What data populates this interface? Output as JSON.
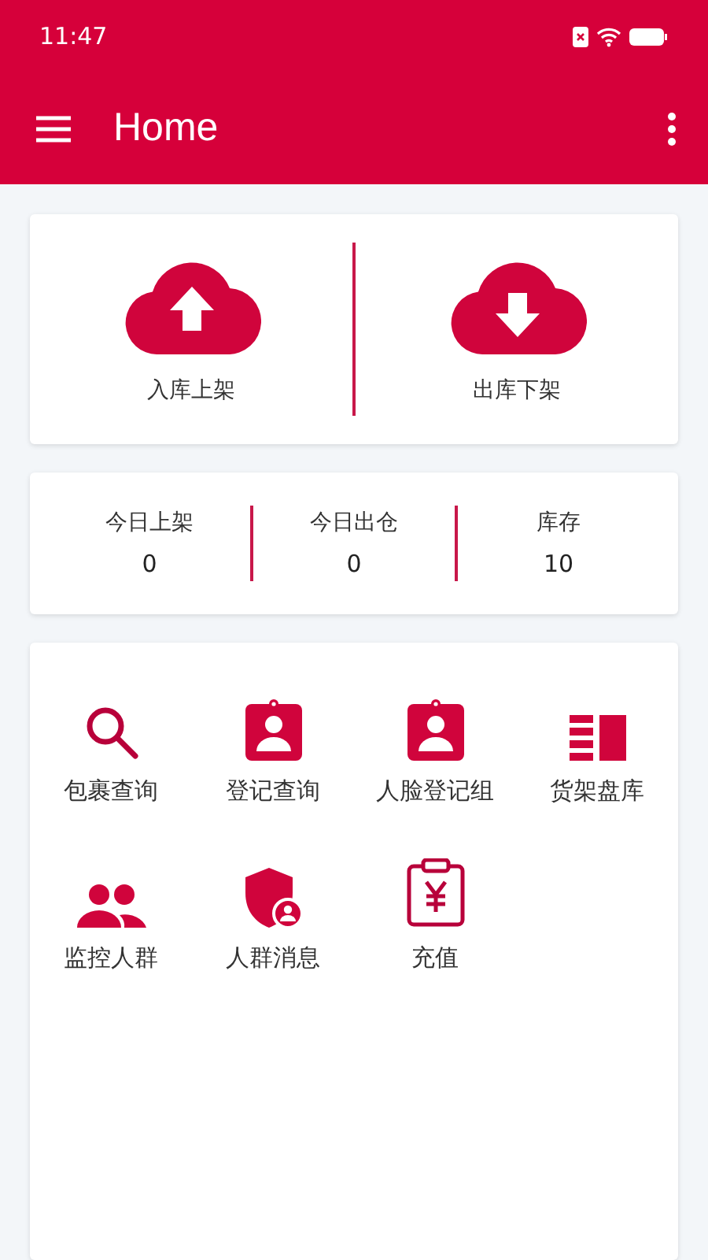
{
  "status_bar": {
    "time": "11:47"
  },
  "app_bar": {
    "title": "Home"
  },
  "actions": [
    {
      "label": "入库上架"
    },
    {
      "label": "出库下架"
    }
  ],
  "stats": [
    {
      "label": "今日上架",
      "value": "0"
    },
    {
      "label": "今日出仓",
      "value": "0"
    },
    {
      "label": "库存",
      "value": "10"
    }
  ],
  "features": [
    {
      "label": "包裹查询"
    },
    {
      "label": "登记查询"
    },
    {
      "label": "人脸登记组"
    },
    {
      "label": "货架盘库"
    },
    {
      "label": "监控人群"
    },
    {
      "label": "人群消息"
    },
    {
      "label": "充值"
    }
  ]
}
